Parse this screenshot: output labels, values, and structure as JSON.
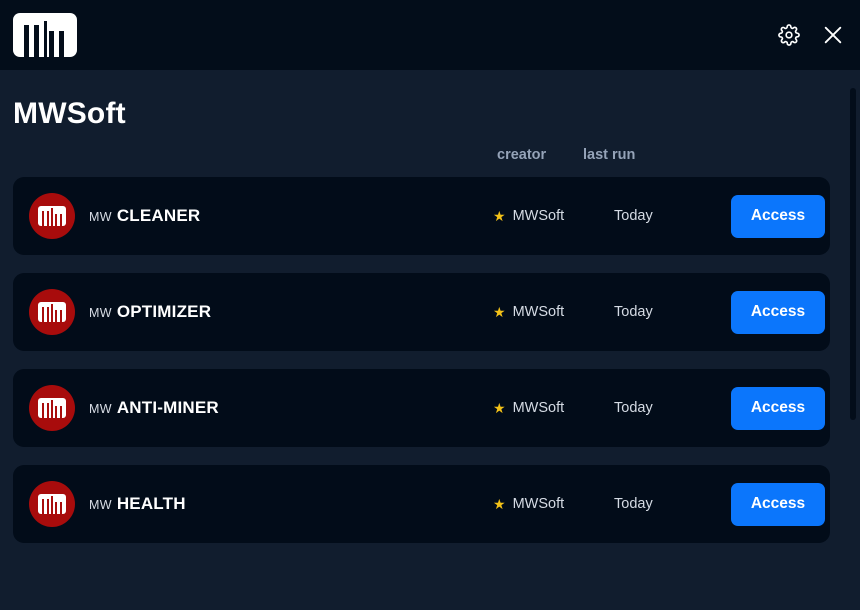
{
  "titlebar": {
    "logo_name": "MW",
    "settings_icon": "gear-icon",
    "close_icon": "close-icon"
  },
  "page": {
    "title": "MWSoft"
  },
  "columns": {
    "creator": "creator",
    "last_run": "last run"
  },
  "apps": [
    {
      "prefix": "MW",
      "name": "CLEANER",
      "star": "★",
      "creator": "MWSoft",
      "last_run": "Today",
      "action": "Access"
    },
    {
      "prefix": "MW",
      "name": "OPTIMIZER",
      "star": "★",
      "creator": "MWSoft",
      "last_run": "Today",
      "action": "Access"
    },
    {
      "prefix": "MW",
      "name": "ANTI-MINER",
      "star": "★",
      "creator": "MWSoft",
      "last_run": "Today",
      "action": "Access"
    },
    {
      "prefix": "MW",
      "name": "HEALTH",
      "star": "★",
      "creator": "MWSoft",
      "last_run": "Today",
      "action": "Access"
    }
  ],
  "colors": {
    "titlebar_bg": "#030d1a",
    "page_bg": "#111d2e",
    "card_bg": "#020c19",
    "accent_blue": "#0b76fc",
    "avatar_red": "#a80c0c",
    "star_gold": "#f3c218",
    "header_text": "#95a3b8"
  }
}
